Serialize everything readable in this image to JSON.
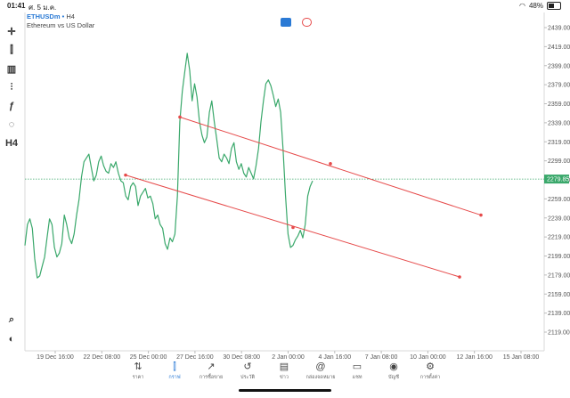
{
  "status": {
    "time": "01:41",
    "date": "ศ. 5 ม.ค.",
    "battery": "48%",
    "battery_level": 0.48
  },
  "symbol": {
    "name": "ETHUSDm",
    "dot": "•",
    "timeframe": "H4",
    "description": "Ethereum vs US Dollar"
  },
  "toolbar": [
    {
      "name": "crosshair-icon",
      "glyph": "✛"
    },
    {
      "name": "chart-type-icon",
      "glyph": "⫿"
    },
    {
      "name": "indicators-icon",
      "glyph": "▥"
    },
    {
      "name": "settings-sliders-icon",
      "glyph": "⫶"
    },
    {
      "name": "function-icon",
      "glyph": "ƒ"
    },
    {
      "name": "objects-icon",
      "glyph": "◌"
    },
    {
      "name": "timeframe-button",
      "glyph": "H4"
    }
  ],
  "price_axis": {
    "ticks": [
      "2439.00",
      "2419.00",
      "2399.00",
      "2379.00",
      "2359.00",
      "2339.00",
      "2319.00",
      "2299.00",
      "2279.00",
      "2259.00",
      "2239.00",
      "2219.00",
      "2199.00",
      "2179.00",
      "2159.00",
      "2139.00",
      "2119.00"
    ],
    "current_price": "2279.85"
  },
  "time_axis": {
    "ticks": [
      "19 Dec 16:00",
      "22 Dec 08:00",
      "25 Dec 00:00",
      "27 Dec 16:00",
      "30 Dec 08:00",
      "2 Jan 00:00",
      "4 Jan 16:00",
      "7 Jan 08:00",
      "10 Jan 00:00",
      "12 Jan 16:00",
      "15 Jan 08:00"
    ]
  },
  "chart_data": {
    "type": "line",
    "title": "",
    "symbol": "ETHUSDm",
    "timeframe": "H4",
    "ylim": [
      2110,
      2446
    ],
    "x_ticks": [
      "19 Dec 16:00",
      "22 Dec 08:00",
      "25 Dec 00:00",
      "27 Dec 16:00",
      "30 Dec 08:00",
      "2 Jan 00:00",
      "4 Jan 16:00",
      "7 Jan 08:00",
      "10 Jan 00:00",
      "12 Jan 16:00",
      "15 Jan 08:00"
    ],
    "series": [
      {
        "color": "#3aa86b",
        "values": [
          2210,
          2232,
          2238,
          2228,
          2196,
          2176,
          2178,
          2188,
          2198,
          2218,
          2238,
          2232,
          2208,
          2198,
          2202,
          2212,
          2242,
          2232,
          2218,
          2212,
          2222,
          2242,
          2258,
          2282,
          2298,
          2302,
          2306,
          2292,
          2278,
          2284,
          2298,
          2304,
          2294,
          2288,
          2286,
          2296,
          2292,
          2298,
          2286,
          2278,
          2276,
          2262,
          2258,
          2272,
          2276,
          2272,
          2252,
          2262,
          2266,
          2270,
          2260,
          2262,
          2254,
          2238,
          2242,
          2232,
          2228,
          2212,
          2206,
          2218,
          2214,
          2222,
          2262,
          2340,
          2372,
          2392,
          2412,
          2394,
          2362,
          2380,
          2366,
          2340,
          2326,
          2318,
          2324,
          2350,
          2362,
          2340,
          2322,
          2302,
          2298,
          2306,
          2302,
          2296,
          2312,
          2318,
          2298,
          2290,
          2296,
          2286,
          2282,
          2292,
          2286,
          2280,
          2294,
          2312,
          2340,
          2362,
          2380,
          2384,
          2378,
          2368,
          2356,
          2364,
          2350,
          2310,
          2262,
          2222,
          2208,
          2210,
          2216,
          2220,
          2226,
          2218,
          2232,
          2262,
          2272,
          2278
        ]
      }
    ],
    "current_price": 2279.85,
    "trendlines": [
      {
        "color": "#e64a4a",
        "start": {
          "time": "27 Dec 16:00",
          "price": 2345
        },
        "end": {
          "time": "12 Jan 16:00",
          "price": 2242
        },
        "anchor": {
          "time": "4 Jan 16:00",
          "price": 2296
        }
      },
      {
        "color": "#e64a4a",
        "start": {
          "time": "25 Dec 00:00",
          "price": 2284
        },
        "end": {
          "time": "12 Jan 08:00",
          "price": 2177
        },
        "anchor": {
          "time": "2 Jan 00:00",
          "price": 2229
        }
      }
    ]
  },
  "bottom_nav": [
    {
      "name": "nav-quotes",
      "icon": "quotes-icon",
      "glyph": "⇅",
      "label": "ราคา",
      "active": false
    },
    {
      "name": "nav-chart",
      "icon": "chart-icon",
      "glyph": "⫿",
      "label": "กราฟ",
      "active": true
    },
    {
      "name": "nav-trade",
      "icon": "trade-icon",
      "glyph": "↗",
      "label": "การซื้อขาย",
      "active": false
    },
    {
      "name": "nav-history",
      "icon": "history-icon",
      "glyph": "↺",
      "label": "ประวัติ",
      "active": false
    },
    {
      "name": "nav-news",
      "icon": "news-icon",
      "glyph": "▤",
      "label": "ข่าว",
      "active": false
    },
    {
      "name": "nav-mailbox",
      "icon": "mailbox-icon",
      "glyph": "@",
      "label": "กล่องจดหมาย",
      "active": false
    },
    {
      "name": "nav-chat",
      "icon": "chat-icon",
      "glyph": "▭",
      "label": "แชท",
      "active": false
    },
    {
      "name": "nav-account",
      "icon": "account-icon",
      "glyph": "◉",
      "label": "บัญชี",
      "active": false
    },
    {
      "name": "nav-settings",
      "icon": "gear-icon",
      "glyph": "⚙",
      "label": "การตั้งค่า",
      "active": false
    }
  ]
}
